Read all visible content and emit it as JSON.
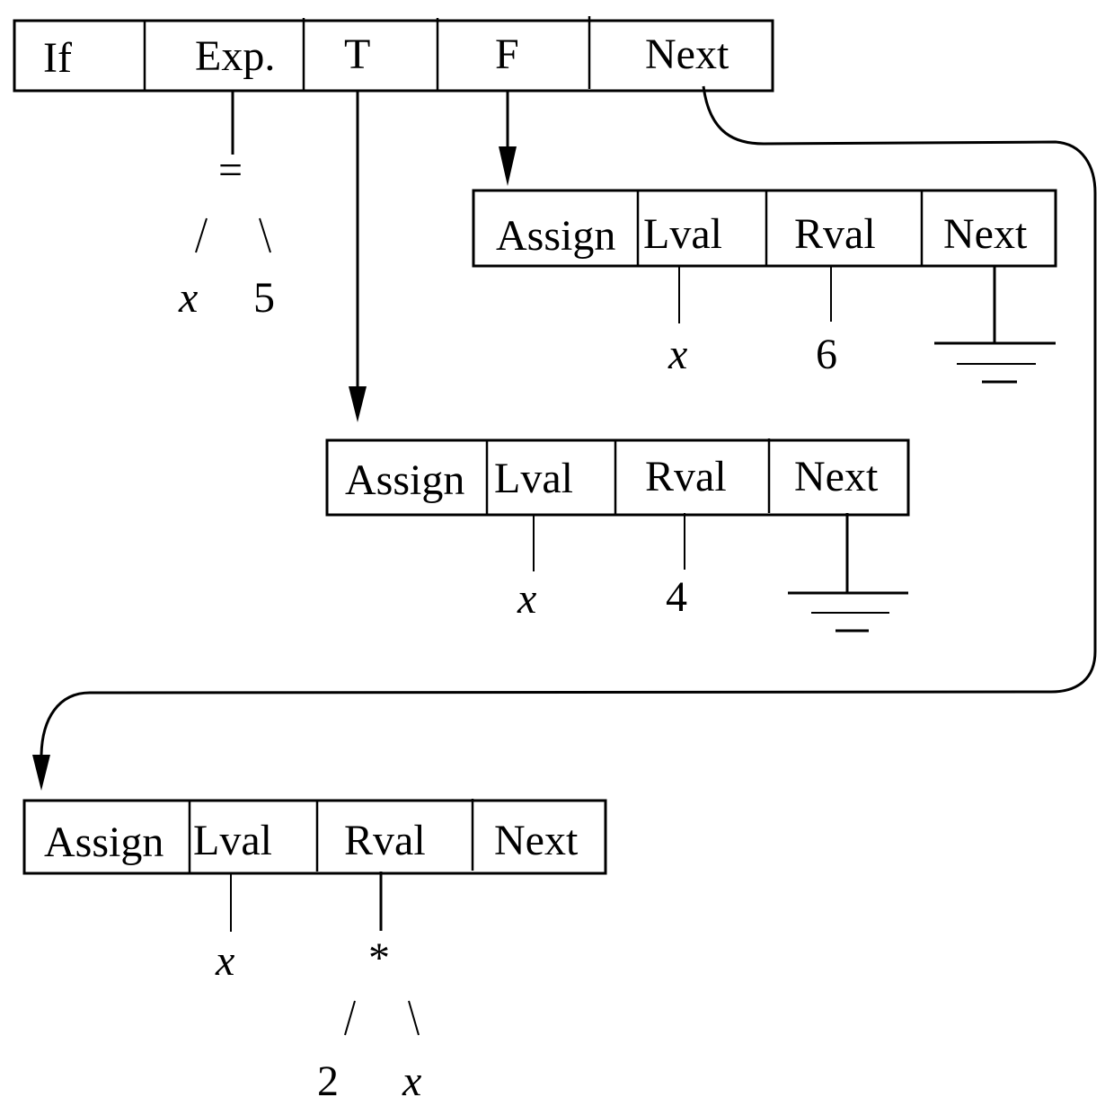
{
  "diagram": {
    "if_node": {
      "fields": [
        "If",
        "Exp.",
        "T",
        "F",
        "Next"
      ],
      "expression": {
        "operator": "=",
        "left": "x",
        "right": "5"
      }
    },
    "false_assign": {
      "fields": [
        "Assign",
        "Lval",
        "Rval",
        "Next"
      ],
      "lval": "x",
      "rval": "6",
      "next": "ground-symbol"
    },
    "true_assign": {
      "fields": [
        "Assign",
        "Lval",
        "Rval",
        "Next"
      ],
      "lval": "x",
      "rval": "4",
      "next": "ground-symbol"
    },
    "next_assign": {
      "fields": [
        "Assign",
        "Lval",
        "Rval",
        "Next"
      ],
      "lval": "x",
      "rval": {
        "operator": "*",
        "left": "2",
        "right": "x"
      }
    },
    "slash_left": "/",
    "slash_right": "\\"
  }
}
